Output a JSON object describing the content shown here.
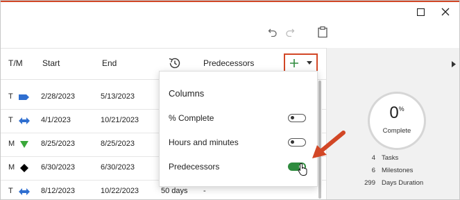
{
  "header": {
    "columns": {
      "tm": "T/M",
      "start": "Start",
      "end": "End",
      "predecessors": "Predecessors"
    },
    "icons": [
      "history-icon",
      "add-icon",
      "dropdown-arrow-icon"
    ]
  },
  "rows": [
    {
      "type": "T",
      "symbol": "task-arrow",
      "start": "2/28/2023",
      "end": "5/13/2023",
      "duration": "",
      "pred": ""
    },
    {
      "type": "T",
      "symbol": "double-arrow",
      "start": "4/1/2023",
      "end": "10/21/2023",
      "duration": "",
      "pred": ""
    },
    {
      "type": "M",
      "symbol": "triangle-down",
      "start": "8/25/2023",
      "end": "8/25/2023",
      "duration": "",
      "pred": ""
    },
    {
      "type": "M",
      "symbol": "diamond",
      "start": "6/30/2023",
      "end": "6/30/2023",
      "duration": "",
      "pred": ""
    },
    {
      "type": "T",
      "symbol": "double-arrow",
      "start": "8/12/2023",
      "end": "10/22/2023",
      "duration": "50 days",
      "pred": "-"
    }
  ],
  "popup": {
    "title": "Columns",
    "items": [
      {
        "label": "% Complete",
        "on": false
      },
      {
        "label": "Hours and minutes",
        "on": false
      },
      {
        "label": "Predecessors",
        "on": true
      }
    ]
  },
  "summary": {
    "percent": "0",
    "percent_sign": "%",
    "complete_label": "Complete",
    "stats": [
      {
        "value": "4",
        "label": "Tasks"
      },
      {
        "value": "6",
        "label": "Milestones"
      },
      {
        "value": "299",
        "label": "Days Duration"
      }
    ]
  },
  "colors": {
    "accent": "#d24726",
    "toggle_on": "#2e8b3e",
    "task_blue": "#2f6fd0",
    "milestone_green": "#3aa83a"
  }
}
